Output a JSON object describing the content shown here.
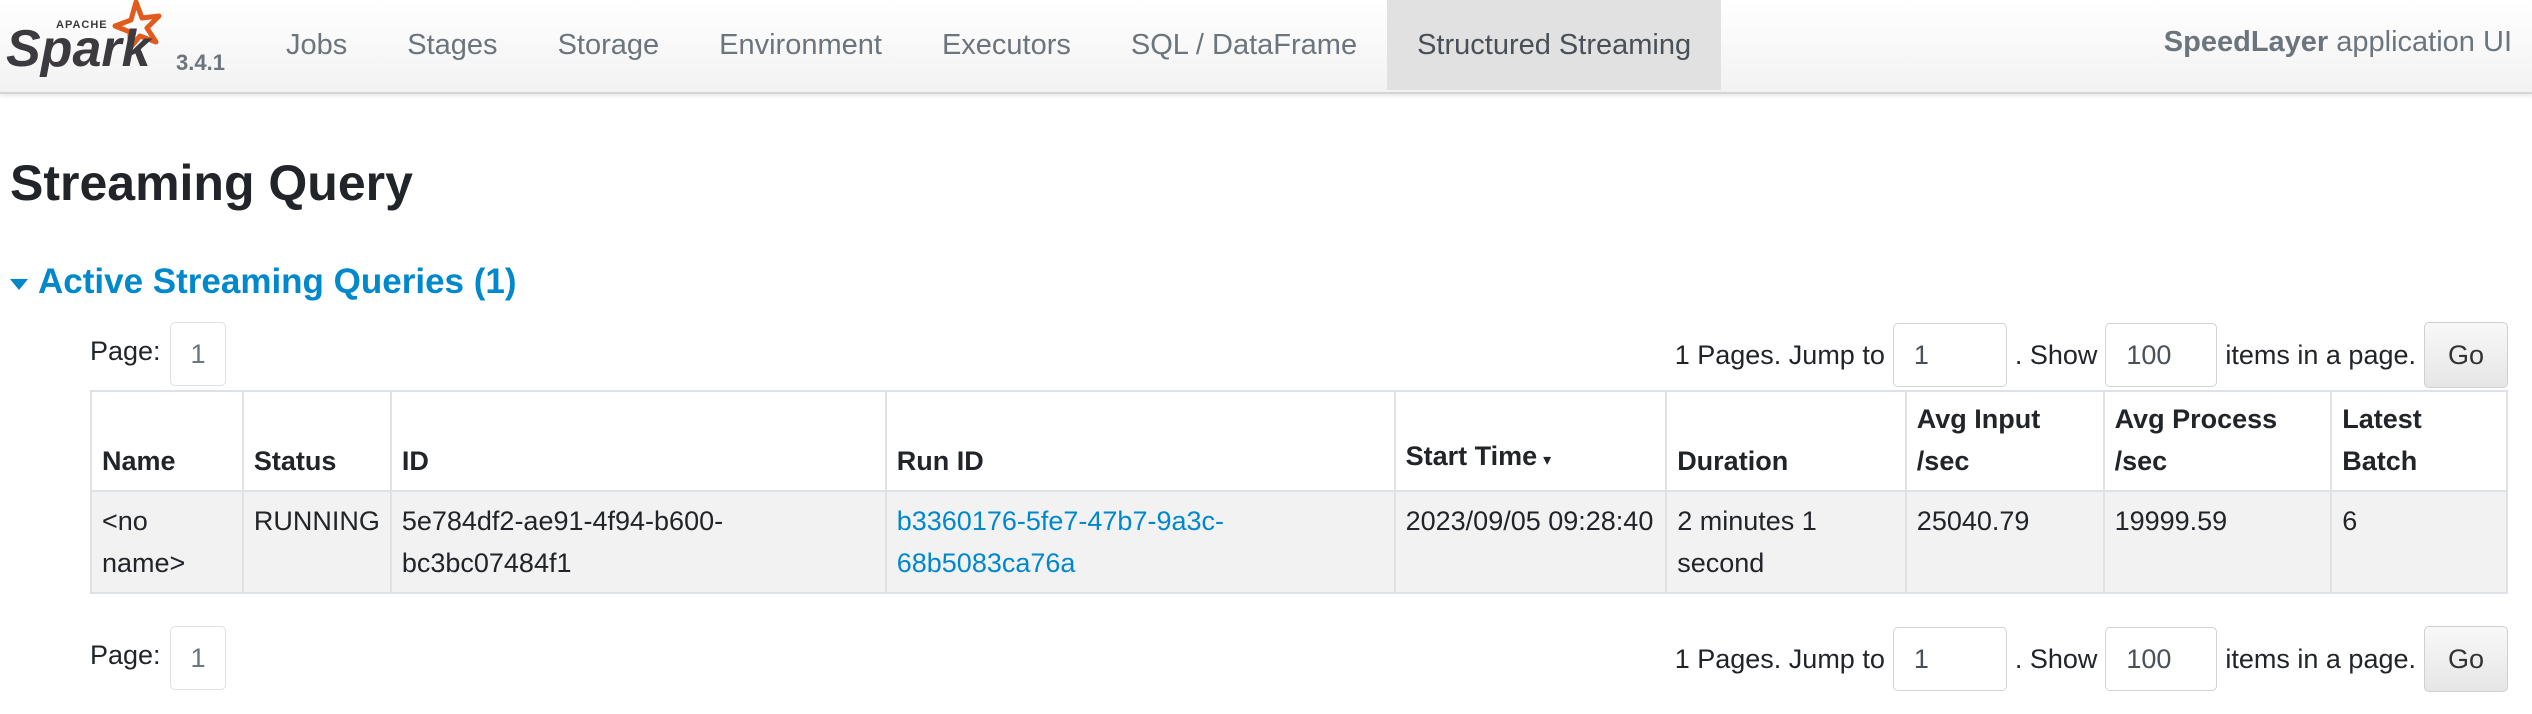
{
  "navbar": {
    "logo_top_text": "APACHE",
    "logo_text": "Spark",
    "version": "3.4.1",
    "tabs": [
      {
        "label": "Jobs",
        "active": false
      },
      {
        "label": "Stages",
        "active": false
      },
      {
        "label": "Storage",
        "active": false
      },
      {
        "label": "Environment",
        "active": false
      },
      {
        "label": "Executors",
        "active": false
      },
      {
        "label": "SQL / DataFrame",
        "active": false
      },
      {
        "label": "Structured Streaming",
        "active": true
      }
    ],
    "app_name": "SpeedLayer",
    "app_suffix": "application UI"
  },
  "page": {
    "title": "Streaming Query",
    "section_title": "Active Streaming Queries (1)"
  },
  "pagination": {
    "page_label": "Page:",
    "current_page": "1",
    "pages_text": "1 Pages. Jump to",
    "jump_value": "1",
    "show_text": ". Show",
    "page_size": "100",
    "items_text": "items in a page.",
    "go_label": "Go"
  },
  "table": {
    "columns": [
      "Name",
      "Status",
      "ID",
      "Run ID",
      "Start Time",
      "Duration",
      "Avg Input /sec",
      "Avg Process /sec",
      "Latest Batch"
    ],
    "sort_indicator": "▾",
    "rows": [
      {
        "name": "<no name>",
        "status": "RUNNING",
        "id": "5e784df2-ae91-4f94-b600-bc3bc07484f1",
        "run_id": "b3360176-5fe7-47b7-9a3c-68b5083ca76a",
        "start_time": "2023/09/05 09:28:40",
        "duration": "2 minutes 1 second",
        "avg_input": "25040.79",
        "avg_process": "19999.59",
        "latest_batch": "6"
      }
    ]
  },
  "colors": {
    "accent": "#0088cc",
    "logo_orange": "#e25a1c",
    "logo_text": "#3c3a3e",
    "active_tab_bg": "#e1e1e1"
  }
}
